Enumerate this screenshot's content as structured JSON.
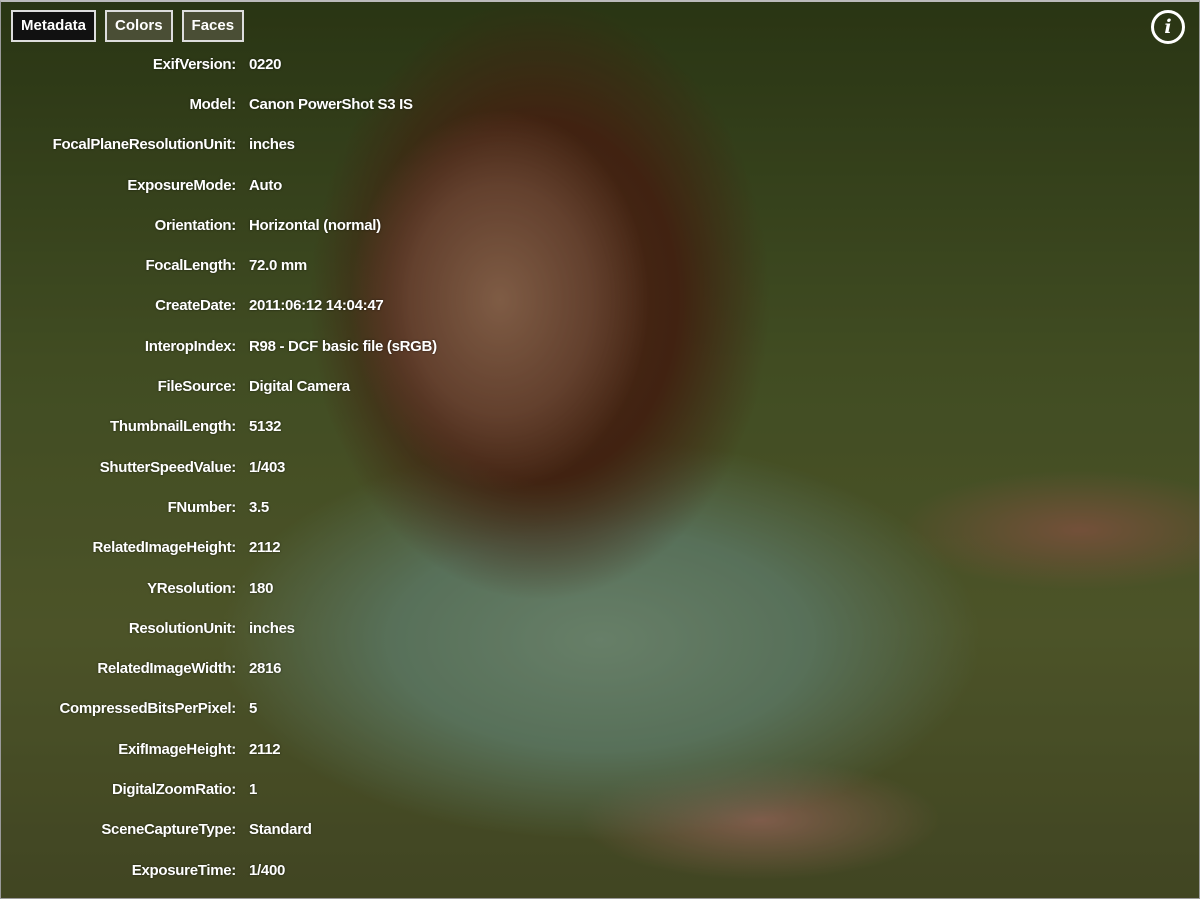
{
  "tabs": [
    {
      "label": "Metadata",
      "active": true
    },
    {
      "label": "Colors",
      "active": false
    },
    {
      "label": "Faces",
      "active": false
    }
  ],
  "info_icon": "info-circle-icon",
  "metadata": [
    {
      "key": "ExifVersion:",
      "value": "0220"
    },
    {
      "key": "Model:",
      "value": "Canon PowerShot S3 IS"
    },
    {
      "key": "FocalPlaneResolutionUnit:",
      "value": "inches"
    },
    {
      "key": "ExposureMode:",
      "value": "Auto"
    },
    {
      "key": "Orientation:",
      "value": "Horizontal (normal)"
    },
    {
      "key": "FocalLength:",
      "value": "72.0 mm"
    },
    {
      "key": "CreateDate:",
      "value": "2011:06:12 14:04:47"
    },
    {
      "key": "InteropIndex:",
      "value": "R98 - DCF basic file (sRGB)"
    },
    {
      "key": "FileSource:",
      "value": "Digital Camera"
    },
    {
      "key": "ThumbnailLength:",
      "value": "5132"
    },
    {
      "key": "ShutterSpeedValue:",
      "value": "1/403"
    },
    {
      "key": "FNumber:",
      "value": "3.5"
    },
    {
      "key": "RelatedImageHeight:",
      "value": "2112"
    },
    {
      "key": "YResolution:",
      "value": "180"
    },
    {
      "key": "ResolutionUnit:",
      "value": "inches"
    },
    {
      "key": "RelatedImageWidth:",
      "value": "2816"
    },
    {
      "key": "CompressedBitsPerPixel:",
      "value": "5"
    },
    {
      "key": "ExifImageHeight:",
      "value": "2112"
    },
    {
      "key": "DigitalZoomRatio:",
      "value": "1"
    },
    {
      "key": "SceneCaptureType:",
      "value": "Standard"
    },
    {
      "key": "ExposureTime:",
      "value": "1/400"
    }
  ]
}
